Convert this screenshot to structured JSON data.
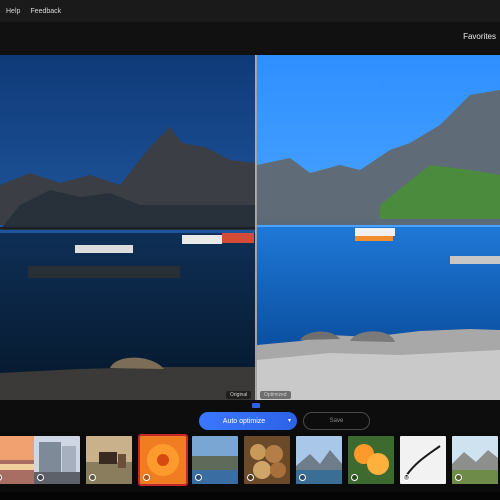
{
  "menu": {
    "items": [
      "Help",
      "Feedback"
    ]
  },
  "header": {
    "favorites_label": "Favorites"
  },
  "viewer": {
    "before_label": "Original",
    "after_label": "Optimized"
  },
  "actions": {
    "auto_optimize_label": "Auto optimize",
    "save_label": "Save"
  },
  "colors": {
    "accent": "#3a77ff",
    "selected_outline": "#c22a2a"
  },
  "filmstrip": {
    "thumbnails": [
      {
        "name": "sunset-beach"
      },
      {
        "name": "street-building"
      },
      {
        "name": "horse-cart"
      },
      {
        "name": "orange-flower",
        "selected": true
      },
      {
        "name": "coastal-scene"
      },
      {
        "name": "pastries"
      },
      {
        "name": "mountain-lake"
      },
      {
        "name": "orange-flowers"
      },
      {
        "name": "abstract-white"
      },
      {
        "name": "mountain-field"
      }
    ]
  }
}
